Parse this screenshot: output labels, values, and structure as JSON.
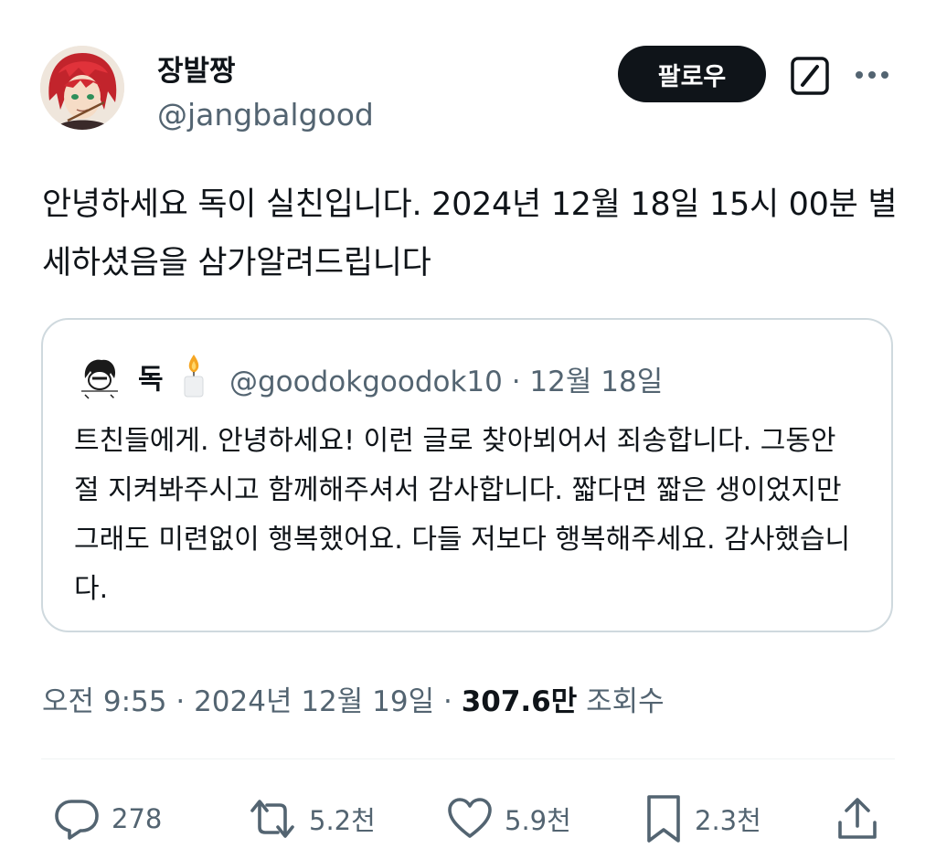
{
  "author": {
    "display_name": "장발짱",
    "handle": "@jangbalgood",
    "follow_label": "팔로우"
  },
  "tweet": {
    "text": "안녕하세요 독이 실친입니다. 2024년 12월 18일 15시 00분 별세하셨음을 삼가알려드립니다"
  },
  "quote": {
    "display_name": "독",
    "handle_date": "@goodokgoodok10 · 12월 18일",
    "text": "트친들에게. 안녕하세요! 이런 글로 찾아뵈어서 죄송합니다. 그동안 절 지켜봐주시고 함께해주셔서 감사합니다. 짧다면 짧은 생이었지만 그래도 미련없이 행복했어요. 다들 저보다 행복해주세요. 감사했습니다."
  },
  "meta": {
    "timestamp": "오전 9:55 · 2024년 12월 19일 · ",
    "views_count": "307.6만",
    "views_label": "조회수"
  },
  "actions": {
    "reply_count": "278",
    "retweet_count": "5.2천",
    "like_count": "5.9천",
    "bookmark_count": "2.3천"
  },
  "icons": [
    "grok-icon",
    "more-icon",
    "candle-icon",
    "reply-icon",
    "retweet-icon",
    "like-icon",
    "bookmark-icon",
    "share-icon"
  ],
  "colors": {
    "text": "#0f1419",
    "secondary": "#536471",
    "border": "#cfd9de",
    "button": "#0f1419"
  }
}
